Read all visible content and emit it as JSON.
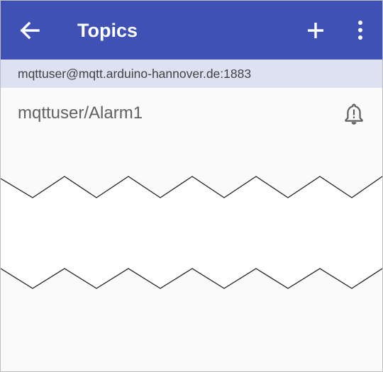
{
  "appbar": {
    "title": "Topics",
    "back_icon": "arrow-back-icon",
    "add_icon": "plus-icon",
    "more_icon": "more-vert-icon",
    "color": "#3f51b5"
  },
  "connection": {
    "label": "mqttuser@mqtt.arduino-hannover.de:1883"
  },
  "topics": [
    {
      "name": "mqttuser/Alarm1",
      "icon": "alarm-bell-icon"
    }
  ]
}
